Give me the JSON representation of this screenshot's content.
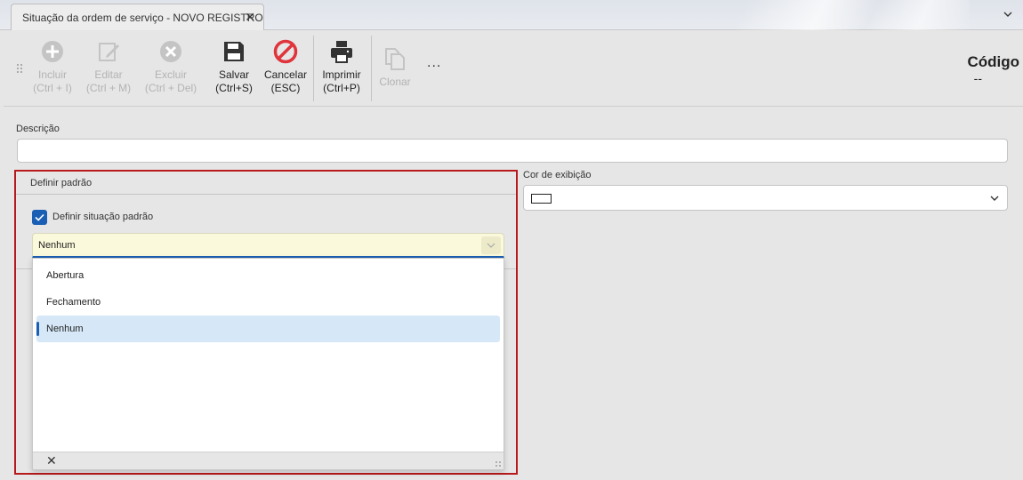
{
  "tab": {
    "title": "Situação da ordem de serviço - NOVO REGISTRO"
  },
  "toolbar": {
    "buttons": [
      {
        "label": "Incluir",
        "shortcut": "(Ctrl + I)",
        "icon": "add-circle-icon",
        "enabled": false
      },
      {
        "label": "Editar",
        "shortcut": "(Ctrl + M)",
        "icon": "edit-icon",
        "enabled": false
      },
      {
        "label": "Excluir",
        "shortcut": "(Ctrl + Del)",
        "icon": "delete-circle-icon",
        "enabled": false
      },
      {
        "label": "Salvar",
        "shortcut": "(Ctrl+S)",
        "icon": "save-icon",
        "enabled": true
      },
      {
        "label": "Cancelar",
        "shortcut": "(ESC)",
        "icon": "cancel-icon",
        "enabled": true
      },
      {
        "label": "Imprimir",
        "shortcut": "(Ctrl+P)",
        "icon": "print-icon",
        "enabled": true
      },
      {
        "label": "Clonar",
        "shortcut": "",
        "icon": "clone-icon",
        "enabled": false
      }
    ],
    "more": "..."
  },
  "codigo": {
    "label": "Código",
    "value": "--"
  },
  "form": {
    "descricao_label": "Descrição",
    "descricao_value": "",
    "group_title": "Definir padrão",
    "checkbox_label": "Definir situação padrão",
    "checkbox_checked": true,
    "combo_value": "Nenhum",
    "options": [
      "Abertura",
      "Fechamento",
      "Nenhum"
    ],
    "selected_option": "Nenhum",
    "cor_label": "Cor de exibição",
    "cor_value": "#ffffff"
  },
  "colors": {
    "accent": "#1a5fb4",
    "highlight_border": "#b7191c",
    "cancel_red": "#e0343c"
  }
}
